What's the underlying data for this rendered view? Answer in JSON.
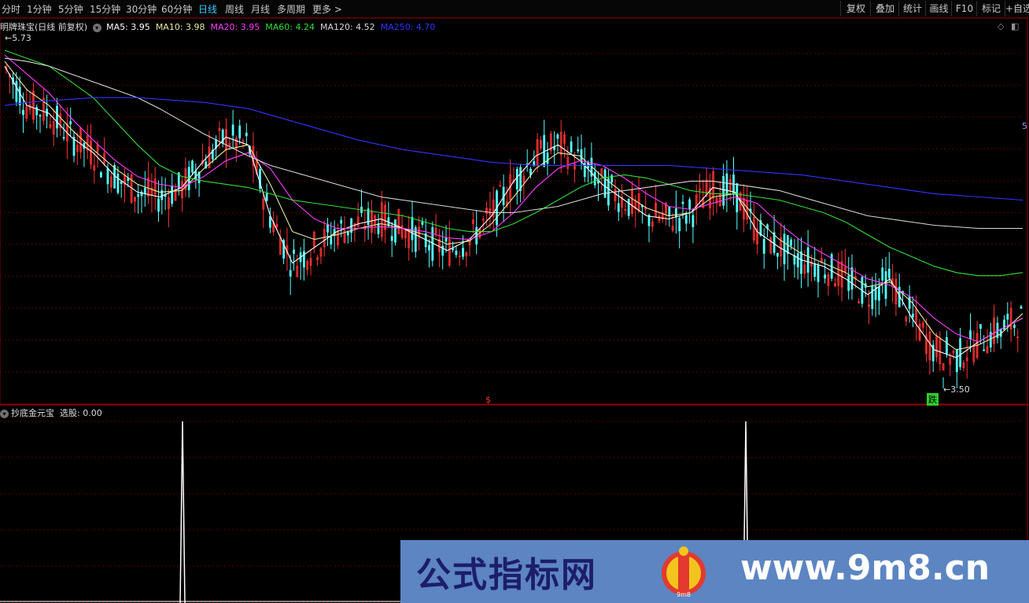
{
  "toolbar": {
    "periods": [
      {
        "label": "分时",
        "active": false
      },
      {
        "label": "1分钟",
        "active": false
      },
      {
        "label": "5分钟",
        "active": false
      },
      {
        "label": "15分钟",
        "active": false
      },
      {
        "label": "30分钟",
        "active": false
      },
      {
        "label": "60分钟",
        "active": false
      },
      {
        "label": "日线",
        "active": true
      },
      {
        "label": "周线",
        "active": false
      },
      {
        "label": "月线",
        "active": false
      },
      {
        "label": "多周期",
        "active": false
      },
      {
        "label": "更多 >",
        "active": false
      }
    ],
    "right_buttons": [
      "复权",
      "叠加",
      "统计",
      "画线",
      "F10",
      "标记",
      "+自选"
    ]
  },
  "main_panel": {
    "title": "明牌珠宝(日线 前复权)",
    "ma_legend": [
      {
        "label": "MA5: 3.95",
        "color": "#ffffff"
      },
      {
        "label": "MA10: 3.98",
        "color": "#e8e8a0"
      },
      {
        "label": "MA20: 3.95",
        "color": "#ff3cff"
      },
      {
        "label": "MA60: 4.24",
        "color": "#33dd33"
      },
      {
        "label": "MA120: 4.52",
        "color": "#d8d8d8"
      },
      {
        "label": "MA250: 4.70",
        "color": "#3333ff"
      }
    ],
    "high_label": "5.73",
    "low_label": "3.50",
    "edge_label": "5",
    "signal_label": "跌",
    "dollar_marker": "$"
  },
  "sub_panel": {
    "title": "抄底金元宝",
    "value_label": "选股: 0.00",
    "spikes": [
      0.0,
      0.0
    ]
  },
  "watermark": {
    "text": "公式指标网",
    "logo_text": "9m8",
    "url": "www.9m8.cn"
  },
  "colors": {
    "up": "#ff3232",
    "down": "#54ffff",
    "grid": "#5a0000",
    "ma5": "#ffffff",
    "ma10": "#e8e8a0",
    "ma20": "#ff3cff",
    "ma60": "#33dd33",
    "ma120": "#d8d8d8",
    "ma250": "#3333ff"
  },
  "chart_data": {
    "type": "candlestick",
    "price_range": [
      3.5,
      5.73
    ],
    "series": [
      {
        "name": "MA5",
        "values": [
          5.55,
          5.3,
          5.25,
          5.1,
          5.0,
          4.85,
          4.75,
          4.72,
          4.78,
          4.95,
          5.1,
          5.05,
          4.6,
          4.3,
          4.4,
          4.5,
          4.55,
          4.58,
          4.52,
          4.45,
          4.38,
          4.45,
          4.6,
          4.82,
          4.98,
          5.05,
          4.95,
          4.8,
          4.7,
          4.6,
          4.58,
          4.62,
          4.78,
          4.75,
          4.5,
          4.4,
          4.32,
          4.28,
          4.2,
          4.1,
          4.2,
          3.95,
          3.75,
          3.7,
          3.8,
          3.88,
          3.95
        ]
      },
      {
        "name": "MA10",
        "values": [
          5.58,
          5.4,
          5.3,
          5.15,
          5.02,
          4.9,
          4.8,
          4.75,
          4.76,
          4.9,
          5.02,
          5.05,
          4.8,
          4.5,
          4.45,
          4.48,
          4.52,
          4.55,
          4.52,
          4.48,
          4.42,
          4.44,
          4.55,
          4.72,
          4.9,
          5.0,
          4.98,
          4.85,
          4.74,
          4.65,
          4.6,
          4.62,
          4.72,
          4.74,
          4.58,
          4.45,
          4.36,
          4.3,
          4.24,
          4.15,
          4.18,
          4.05,
          3.85,
          3.75,
          3.78,
          3.85,
          3.98
        ]
      },
      {
        "name": "MA20",
        "values": [
          5.62,
          5.5,
          5.38,
          5.22,
          5.08,
          4.95,
          4.85,
          4.8,
          4.78,
          4.85,
          4.95,
          5.0,
          4.9,
          4.7,
          4.58,
          4.52,
          4.52,
          4.53,
          4.52,
          4.5,
          4.46,
          4.45,
          4.5,
          4.62,
          4.78,
          4.9,
          4.95,
          4.92,
          4.84,
          4.74,
          4.66,
          4.64,
          4.68,
          4.72,
          4.68,
          4.55,
          4.44,
          4.36,
          4.28,
          4.2,
          4.16,
          4.08,
          3.95,
          3.85,
          3.8,
          3.88,
          3.95
        ]
      },
      {
        "name": "MA60",
        "values": [
          5.65,
          5.6,
          5.55,
          5.45,
          5.35,
          5.2,
          5.05,
          4.92,
          4.85,
          4.82,
          4.8,
          4.78,
          4.74,
          4.7,
          4.68,
          4.66,
          4.64,
          4.62,
          4.6,
          4.56,
          4.52,
          4.5,
          4.5,
          4.55,
          4.62,
          4.7,
          4.78,
          4.84,
          4.86,
          4.84,
          4.8,
          4.76,
          4.74,
          4.74,
          4.72,
          4.7,
          4.66,
          4.62,
          4.56,
          4.48,
          4.4,
          4.34,
          4.28,
          4.24,
          4.22,
          4.22,
          4.24
        ]
      },
      {
        "name": "MA120",
        "values": [
          5.6,
          5.58,
          5.55,
          5.5,
          5.45,
          5.4,
          5.35,
          5.28,
          5.2,
          5.12,
          5.05,
          4.98,
          4.92,
          4.88,
          4.84,
          4.8,
          4.76,
          4.72,
          4.7,
          4.68,
          4.66,
          4.64,
          4.62,
          4.62,
          4.64,
          4.66,
          4.7,
          4.74,
          4.76,
          4.78,
          4.8,
          4.82,
          4.82,
          4.8,
          4.78,
          4.76,
          4.72,
          4.68,
          4.64,
          4.6,
          4.58,
          4.56,
          4.54,
          4.53,
          4.52,
          4.52,
          4.52
        ]
      },
      {
        "name": "MA250",
        "values": [
          5.3,
          5.32,
          5.33,
          5.34,
          5.35,
          5.35,
          5.35,
          5.34,
          5.33,
          5.32,
          5.3,
          5.28,
          5.24,
          5.2,
          5.16,
          5.12,
          5.08,
          5.05,
          5.02,
          5.0,
          4.98,
          4.96,
          4.94,
          4.93,
          4.92,
          4.92,
          4.92,
          4.92,
          4.92,
          4.92,
          4.92,
          4.91,
          4.9,
          4.89,
          4.88,
          4.87,
          4.86,
          4.84,
          4.82,
          4.8,
          4.78,
          4.76,
          4.74,
          4.73,
          4.72,
          4.71,
          4.7
        ]
      }
    ]
  }
}
